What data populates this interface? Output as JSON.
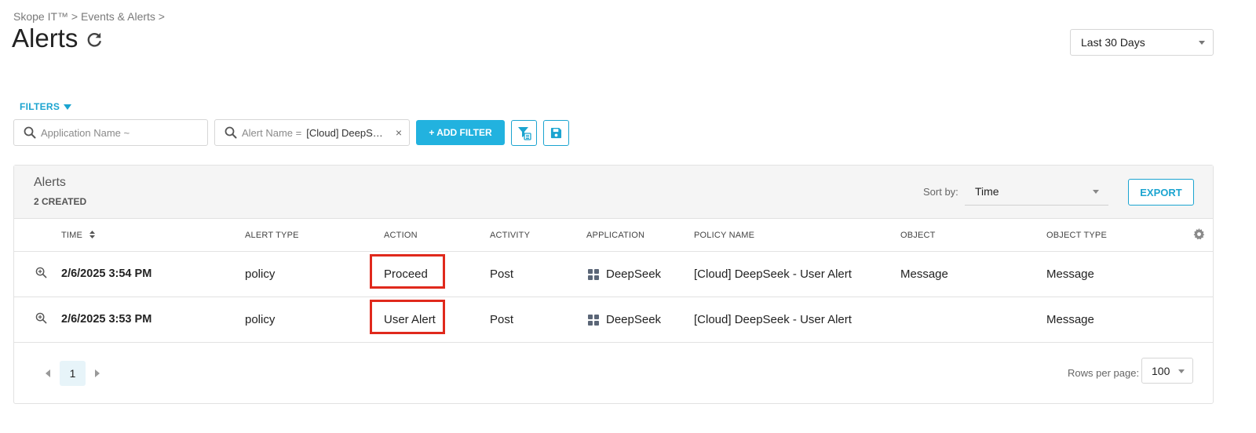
{
  "breadcrumb": "Skope IT™ > Events & Alerts >",
  "page_title": "Alerts",
  "date_range": "Last 30 Days",
  "filters": {
    "toggle_label": "FILTERS",
    "app_placeholder": "Application Name ~",
    "alert_label": "Alert Name =",
    "alert_value": "[Cloud] DeepSe...",
    "remove_symbol": "×",
    "add_label": "+ ADD FILTER"
  },
  "panel": {
    "title": "Alerts",
    "count_text": "2 CREATED",
    "sort_label": "Sort by:",
    "sort_value": "Time",
    "export_label": "EXPORT"
  },
  "columns": [
    "TIME",
    "ALERT TYPE",
    "ACTION",
    "ACTIVITY",
    "APPLICATION",
    "POLICY NAME",
    "OBJECT",
    "OBJECT TYPE"
  ],
  "rows": [
    {
      "time": "2/6/2025 3:54 PM",
      "alert_type": "policy",
      "action": "Proceed",
      "activity": "Post",
      "application": "DeepSeek",
      "policy_name": "[Cloud] DeepSeek - User Alert",
      "object": "Message",
      "object_type": "Message"
    },
    {
      "time": "2/6/2025 3:53 PM",
      "alert_type": "policy",
      "action": "User Alert",
      "activity": "Post",
      "application": "DeepSeek",
      "policy_name": "[Cloud] DeepSeek - User Alert",
      "object": "",
      "object_type": "Message"
    }
  ],
  "pagination": {
    "current_page": "1",
    "rows_label": "Rows per page:",
    "rows_value": "100"
  },
  "colors": {
    "accent": "#1ba4d0",
    "button_fill": "#22b2df",
    "highlight_box": "#e0291c"
  }
}
